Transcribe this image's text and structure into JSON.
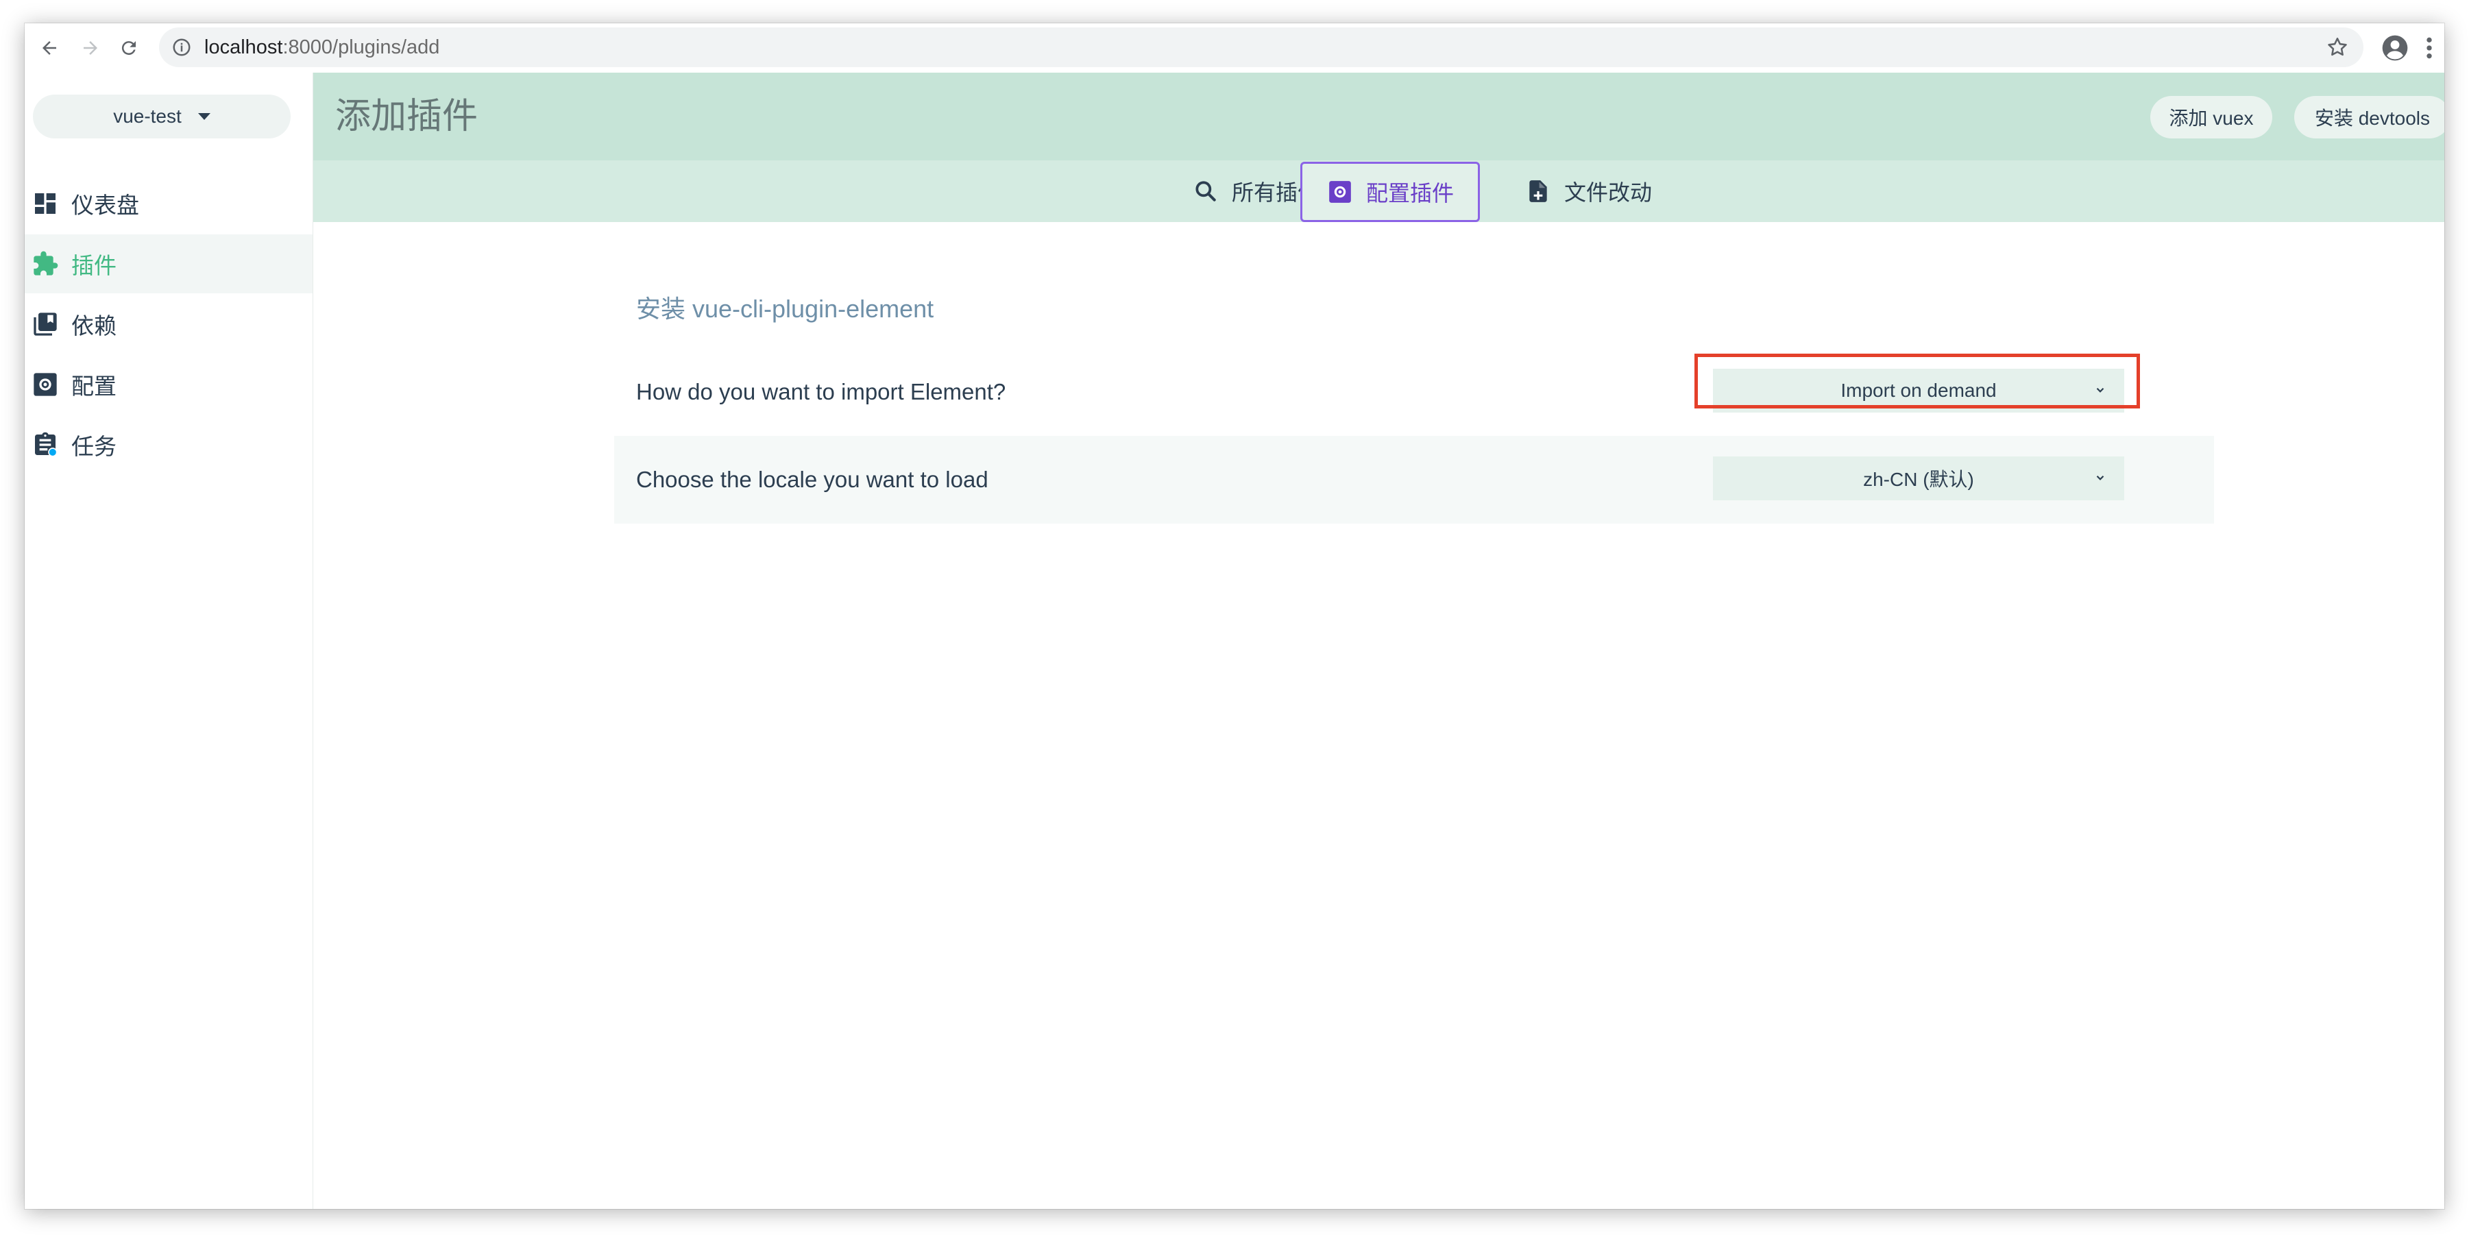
{
  "browser": {
    "url_host": "localhost",
    "url_path": ":8000/plugins/add"
  },
  "sidebar": {
    "project": "vue-test",
    "items": [
      {
        "label": "仪表盘",
        "icon": "dashboard-icon"
      },
      {
        "label": "插件",
        "icon": "puzzle-icon",
        "active": true
      },
      {
        "label": "依赖",
        "icon": "library-icon"
      },
      {
        "label": "配置",
        "icon": "settings-icon"
      },
      {
        "label": "任务",
        "icon": "clipboard-icon"
      }
    ]
  },
  "header": {
    "title": "添加插件",
    "buttons": [
      "添加 vuex",
      "安装 devtools"
    ]
  },
  "tabs": [
    {
      "label": "所有插件",
      "icon": "search-icon"
    },
    {
      "label": "配置插件",
      "icon": "settings-icon",
      "active": true
    },
    {
      "label": "文件改动",
      "icon": "file-add-icon"
    }
  ],
  "main": {
    "section_title": "安装 vue-cli-plugin-element",
    "prompts": [
      {
        "label": "How do you want to import Element?",
        "value": "Import on demand"
      },
      {
        "label": "Choose the locale you want to load",
        "value": "zh-CN (默认)"
      }
    ]
  },
  "colors": {
    "accent_green": "#42b983",
    "header_bg": "#c6e4d7",
    "tab_active": "#6a3fc8",
    "highlight_red": "#e4402a"
  }
}
